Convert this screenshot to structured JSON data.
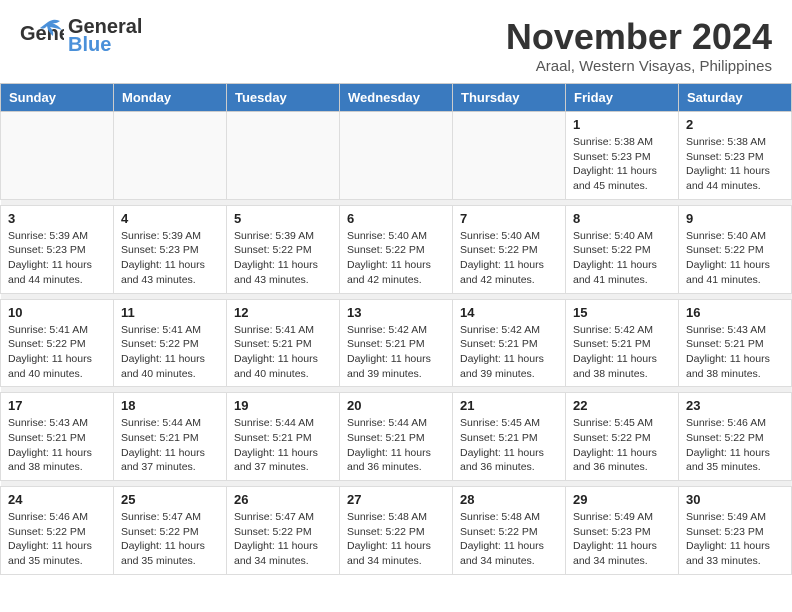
{
  "header": {
    "logo_general": "General",
    "logo_blue": "Blue",
    "month_title": "November 2024",
    "location": "Araal, Western Visayas, Philippines"
  },
  "days_of_week": [
    "Sunday",
    "Monday",
    "Tuesday",
    "Wednesday",
    "Thursday",
    "Friday",
    "Saturday"
  ],
  "weeks": [
    {
      "days": [
        {
          "num": "",
          "info": ""
        },
        {
          "num": "",
          "info": ""
        },
        {
          "num": "",
          "info": ""
        },
        {
          "num": "",
          "info": ""
        },
        {
          "num": "",
          "info": ""
        },
        {
          "num": "1",
          "info": "Sunrise: 5:38 AM\nSunset: 5:23 PM\nDaylight: 11 hours and 45 minutes."
        },
        {
          "num": "2",
          "info": "Sunrise: 5:38 AM\nSunset: 5:23 PM\nDaylight: 11 hours and 44 minutes."
        }
      ]
    },
    {
      "days": [
        {
          "num": "3",
          "info": "Sunrise: 5:39 AM\nSunset: 5:23 PM\nDaylight: 11 hours and 44 minutes."
        },
        {
          "num": "4",
          "info": "Sunrise: 5:39 AM\nSunset: 5:23 PM\nDaylight: 11 hours and 43 minutes."
        },
        {
          "num": "5",
          "info": "Sunrise: 5:39 AM\nSunset: 5:22 PM\nDaylight: 11 hours and 43 minutes."
        },
        {
          "num": "6",
          "info": "Sunrise: 5:40 AM\nSunset: 5:22 PM\nDaylight: 11 hours and 42 minutes."
        },
        {
          "num": "7",
          "info": "Sunrise: 5:40 AM\nSunset: 5:22 PM\nDaylight: 11 hours and 42 minutes."
        },
        {
          "num": "8",
          "info": "Sunrise: 5:40 AM\nSunset: 5:22 PM\nDaylight: 11 hours and 41 minutes."
        },
        {
          "num": "9",
          "info": "Sunrise: 5:40 AM\nSunset: 5:22 PM\nDaylight: 11 hours and 41 minutes."
        }
      ]
    },
    {
      "days": [
        {
          "num": "10",
          "info": "Sunrise: 5:41 AM\nSunset: 5:22 PM\nDaylight: 11 hours and 40 minutes."
        },
        {
          "num": "11",
          "info": "Sunrise: 5:41 AM\nSunset: 5:22 PM\nDaylight: 11 hours and 40 minutes."
        },
        {
          "num": "12",
          "info": "Sunrise: 5:41 AM\nSunset: 5:21 PM\nDaylight: 11 hours and 40 minutes."
        },
        {
          "num": "13",
          "info": "Sunrise: 5:42 AM\nSunset: 5:21 PM\nDaylight: 11 hours and 39 minutes."
        },
        {
          "num": "14",
          "info": "Sunrise: 5:42 AM\nSunset: 5:21 PM\nDaylight: 11 hours and 39 minutes."
        },
        {
          "num": "15",
          "info": "Sunrise: 5:42 AM\nSunset: 5:21 PM\nDaylight: 11 hours and 38 minutes."
        },
        {
          "num": "16",
          "info": "Sunrise: 5:43 AM\nSunset: 5:21 PM\nDaylight: 11 hours and 38 minutes."
        }
      ]
    },
    {
      "days": [
        {
          "num": "17",
          "info": "Sunrise: 5:43 AM\nSunset: 5:21 PM\nDaylight: 11 hours and 38 minutes."
        },
        {
          "num": "18",
          "info": "Sunrise: 5:44 AM\nSunset: 5:21 PM\nDaylight: 11 hours and 37 minutes."
        },
        {
          "num": "19",
          "info": "Sunrise: 5:44 AM\nSunset: 5:21 PM\nDaylight: 11 hours and 37 minutes."
        },
        {
          "num": "20",
          "info": "Sunrise: 5:44 AM\nSunset: 5:21 PM\nDaylight: 11 hours and 36 minutes."
        },
        {
          "num": "21",
          "info": "Sunrise: 5:45 AM\nSunset: 5:21 PM\nDaylight: 11 hours and 36 minutes."
        },
        {
          "num": "22",
          "info": "Sunrise: 5:45 AM\nSunset: 5:22 PM\nDaylight: 11 hours and 36 minutes."
        },
        {
          "num": "23",
          "info": "Sunrise: 5:46 AM\nSunset: 5:22 PM\nDaylight: 11 hours and 35 minutes."
        }
      ]
    },
    {
      "days": [
        {
          "num": "24",
          "info": "Sunrise: 5:46 AM\nSunset: 5:22 PM\nDaylight: 11 hours and 35 minutes."
        },
        {
          "num": "25",
          "info": "Sunrise: 5:47 AM\nSunset: 5:22 PM\nDaylight: 11 hours and 35 minutes."
        },
        {
          "num": "26",
          "info": "Sunrise: 5:47 AM\nSunset: 5:22 PM\nDaylight: 11 hours and 34 minutes."
        },
        {
          "num": "27",
          "info": "Sunrise: 5:48 AM\nSunset: 5:22 PM\nDaylight: 11 hours and 34 minutes."
        },
        {
          "num": "28",
          "info": "Sunrise: 5:48 AM\nSunset: 5:22 PM\nDaylight: 11 hours and 34 minutes."
        },
        {
          "num": "29",
          "info": "Sunrise: 5:49 AM\nSunset: 5:23 PM\nDaylight: 11 hours and 34 minutes."
        },
        {
          "num": "30",
          "info": "Sunrise: 5:49 AM\nSunset: 5:23 PM\nDaylight: 11 hours and 33 minutes."
        }
      ]
    }
  ]
}
